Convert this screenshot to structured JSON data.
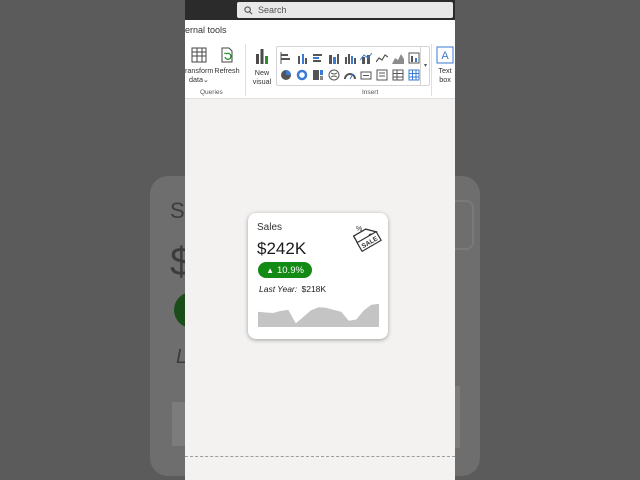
{
  "search": {
    "placeholder": "Search"
  },
  "ribbon": {
    "tab_label": "ernal tools",
    "buttons": {
      "transform_line1": "ransform",
      "transform_line2": "data",
      "refresh": "Refresh",
      "new_visual_line1": "New",
      "new_visual_line2": "visual",
      "text_box_line1": "Text",
      "text_box_line2": "box"
    },
    "groups": {
      "queries": "Queries",
      "insert": "Insert"
    }
  },
  "card": {
    "title": "Sales",
    "value": "$242K",
    "delta": "10.9%",
    "last_year_label": "Last Year:",
    "last_year_value": "$218K",
    "tag_text": "SALE",
    "accent_color": "#138a13",
    "sparkline": [
      0.55,
      0.52,
      0.5,
      0.58,
      0.62,
      0.1,
      0.35,
      0.6,
      0.72,
      0.7,
      0.62,
      0.55,
      0.2,
      0.25,
      0.6,
      0.82,
      0.85
    ]
  },
  "background_echo": {
    "sa": "Sa",
    "dollar": "$",
    "l": "L"
  }
}
